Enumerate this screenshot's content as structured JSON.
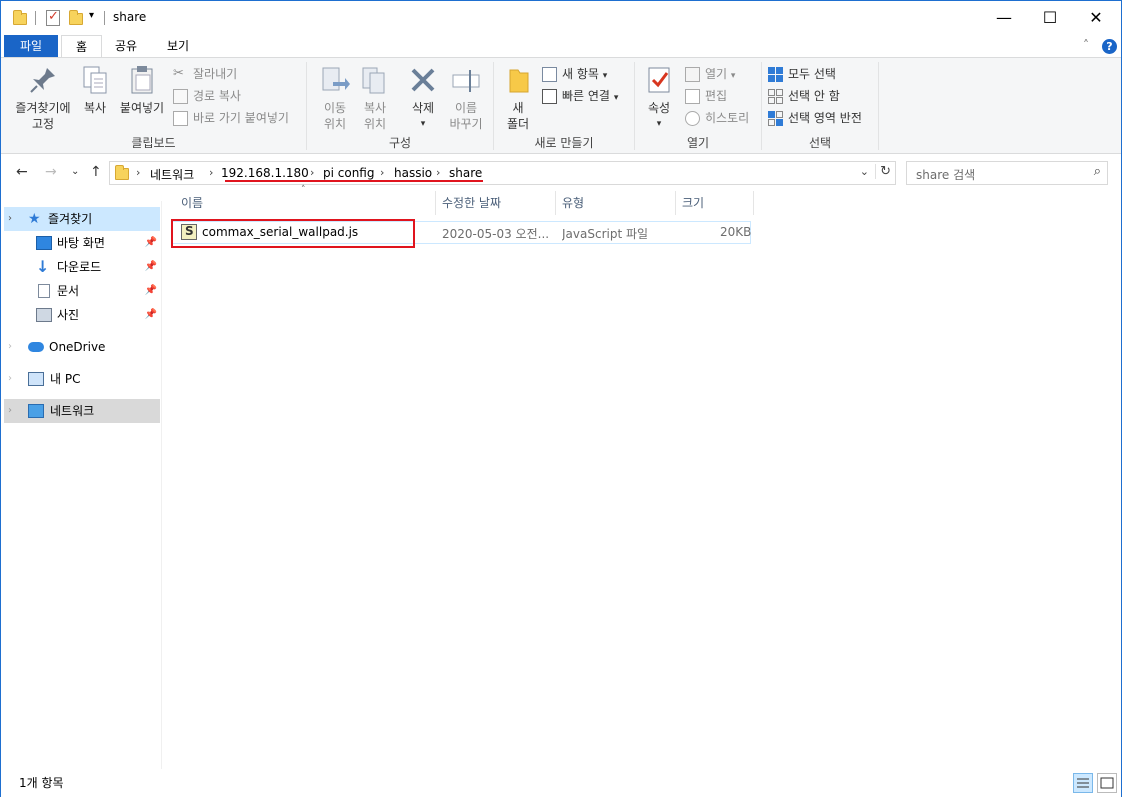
{
  "window": {
    "title": "share"
  },
  "window_controls": {
    "minimize": "—",
    "maximize": "☐",
    "close": "✕"
  },
  "tabs": [
    {
      "label": "파일"
    },
    {
      "label": "홈"
    },
    {
      "label": "공유"
    },
    {
      "label": "보기"
    }
  ],
  "ribbon": {
    "clipboard": {
      "label": "클립보드",
      "pin_line1": "즐겨찾기에",
      "pin_line2": "고정",
      "copy": "복사",
      "paste": "붙여넣기",
      "cut": "잘라내기",
      "copy_path": "경로 복사",
      "paste_shortcut": "바로 가기 붙여넣기"
    },
    "organize": {
      "label": "구성",
      "move_line1": "이동",
      "move_line2": "위치",
      "copyto_line1": "복사",
      "copyto_line2": "위치",
      "delete": "삭제",
      "rename_line1": "이름",
      "rename_line2": "바꾸기"
    },
    "new": {
      "label": "새로 만들기",
      "folder_line1": "새",
      "folder_line2": "폴더",
      "new_item": "새 항목",
      "easy_access": "빠른 연결"
    },
    "open": {
      "label": "열기",
      "properties": "속성",
      "open": "열기",
      "edit": "편집",
      "history": "히스토리"
    },
    "select": {
      "label": "선택",
      "select_all": "모두 선택",
      "select_none": "선택 안 함",
      "invert": "선택 영역 반전"
    }
  },
  "address": {
    "crumbs": [
      "네트워크",
      "192.168.1.180",
      "pi config",
      "hassio",
      "share"
    ]
  },
  "search": {
    "placeholder": "share 검색"
  },
  "sidebar": {
    "quick_access": "즐겨찾기",
    "items": [
      {
        "label": "바탕 화면"
      },
      {
        "label": "다운로드"
      },
      {
        "label": "문서"
      },
      {
        "label": "사진"
      }
    ],
    "onedrive": "OneDrive",
    "this_pc": "내 PC",
    "network": "네트워크"
  },
  "columns": {
    "name": "이름",
    "date": "수정한 날짜",
    "type": "유형",
    "size": "크기"
  },
  "files": [
    {
      "name": "commax_serial_wallpad.js",
      "date": "2020-05-03 오전...",
      "type": "JavaScript 파일",
      "size": "20KB"
    }
  ],
  "status": {
    "count": "1개 항목"
  }
}
